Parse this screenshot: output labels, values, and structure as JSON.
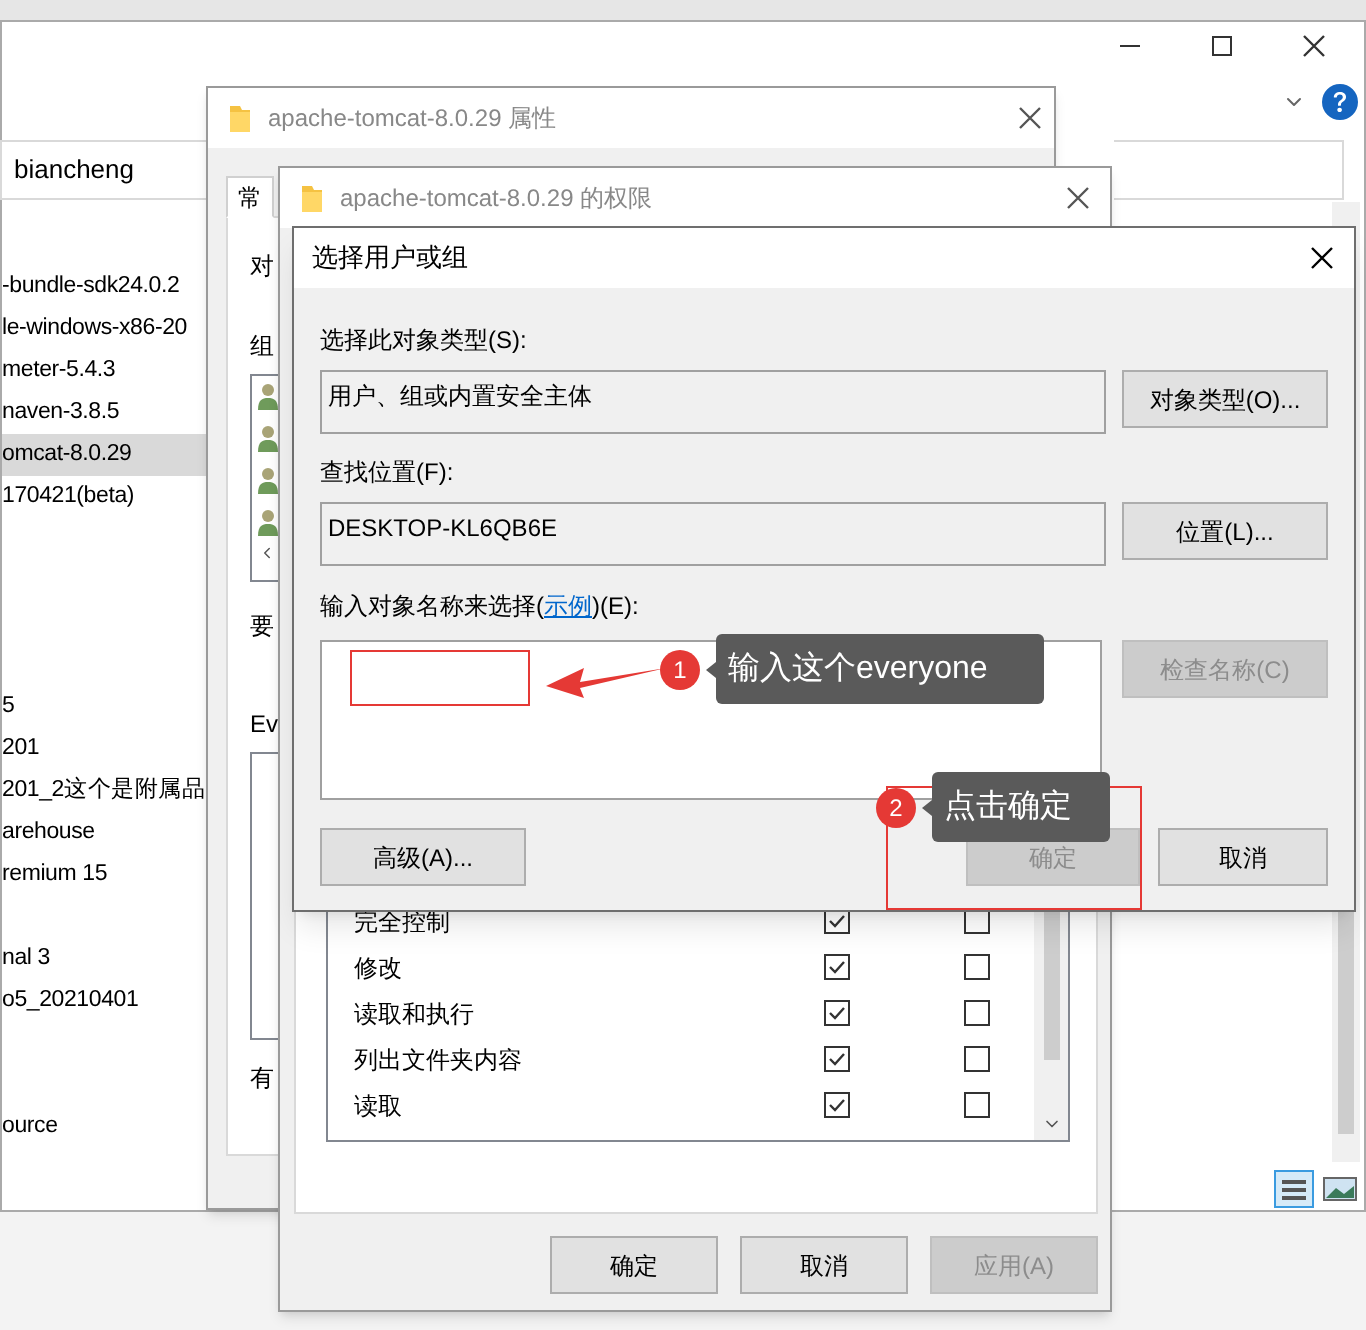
{
  "explorer": {
    "address": "biancheng",
    "file_groups": [
      [
        {
          "name": "-bundle-sdk24.0.2",
          "selected": false
        },
        {
          "name": "le-windows-x86-20",
          "selected": false
        },
        {
          "name": "meter-5.4.3",
          "selected": false
        },
        {
          "name": "naven-3.8.5",
          "selected": false
        },
        {
          "name": "omcat-8.0.29",
          "selected": true
        },
        {
          "name": "170421(beta)",
          "selected": false
        }
      ],
      [
        {
          "name": "5",
          "selected": false
        },
        {
          "name": "201",
          "selected": false
        },
        {
          "name": "201_2这个是附属品",
          "selected": false
        },
        {
          "name": "arehouse",
          "selected": false
        },
        {
          "name": "remium 15",
          "selected": false
        }
      ],
      [
        {
          "name": "nal 3",
          "selected": false
        },
        {
          "name": "o5_20210401",
          "selected": false
        }
      ],
      [
        {
          "name": "ource",
          "selected": false
        }
      ]
    ]
  },
  "properties": {
    "title": "apache-tomcat-8.0.29 属性",
    "tabs": [
      {
        "label": "常",
        "selected": true
      }
    ],
    "fragments": [
      "对",
      "组",
      "要",
      "Ev",
      "有"
    ]
  },
  "permissions": {
    "title": "apache-tomcat-8.0.29 的权限",
    "rows": [
      {
        "name": "完全控制",
        "allow": true,
        "deny": false
      },
      {
        "name": "修改",
        "allow": true,
        "deny": false
      },
      {
        "name": "读取和执行",
        "allow": true,
        "deny": false
      },
      {
        "name": "列出文件夹内容",
        "allow": true,
        "deny": false
      },
      {
        "name": "读取",
        "allow": true,
        "deny": false
      }
    ],
    "buttons": [
      {
        "label": "确定",
        "disabled": false
      },
      {
        "label": "取消",
        "disabled": false
      },
      {
        "label": "应用(A)",
        "disabled": true
      }
    ]
  },
  "dialog": {
    "title": "选择用户或组",
    "object_type": {
      "label": "选择此对象类型(S):",
      "value": "用户、组或内置安全主体",
      "button": "对象类型(O)..."
    },
    "location": {
      "label": "查找位置(F):",
      "value": "DESKTOP-KL6QB6E",
      "button": "位置(L)..."
    },
    "names": {
      "label_before": "输入对象名称来选择(",
      "link": "示例",
      "label_after": ")(E):"
    },
    "check_button": {
      "label": "检查名称(C)",
      "disabled": true
    },
    "buttons": [
      {
        "label": "高级(A)...",
        "disabled": false
      },
      {
        "label": "确定",
        "disabled": true
      },
      {
        "label": "取消",
        "disabled": false
      }
    ]
  },
  "annotations": [
    {
      "number": "1",
      "text": "输入这个everyone"
    },
    {
      "number": "2",
      "text": "点击确定"
    }
  ]
}
